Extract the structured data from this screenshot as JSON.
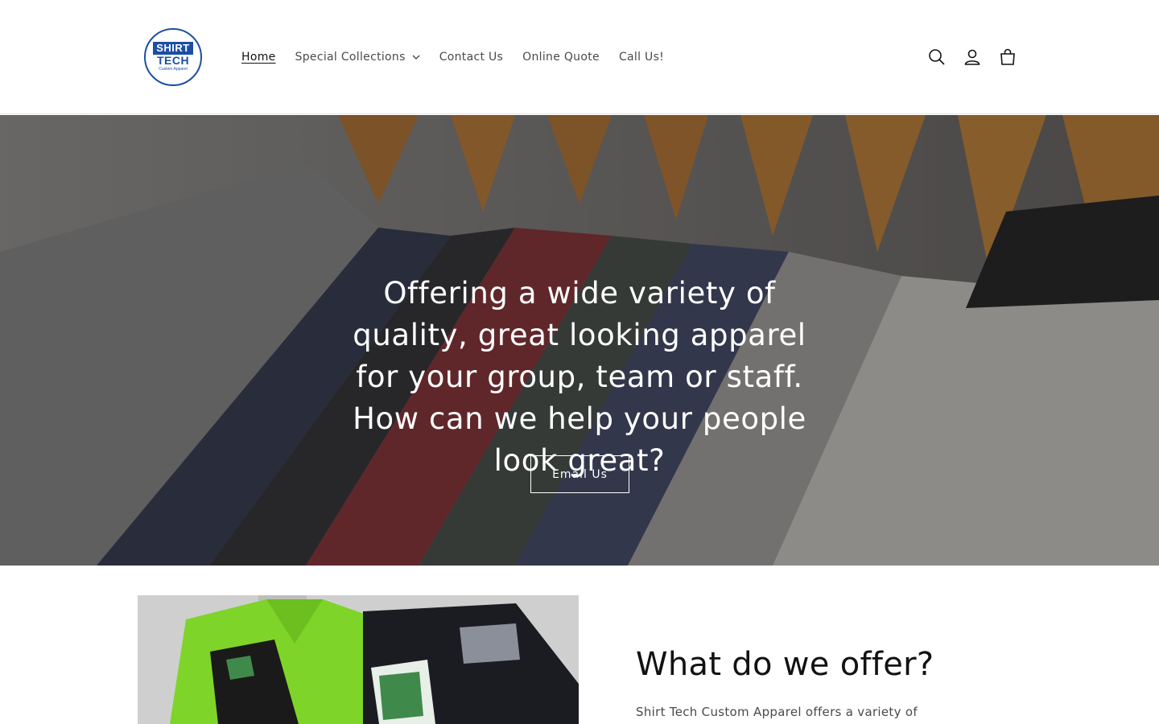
{
  "brand": {
    "logo_line1": "SHIRT",
    "logo_line2": "TECH",
    "logo_line3": "Custom Apparel",
    "color": "#1d4fa3"
  },
  "nav": {
    "items": [
      {
        "label": "Home",
        "active": true
      },
      {
        "label": "Special Collections",
        "dropdown": true
      },
      {
        "label": "Contact Us"
      },
      {
        "label": "Online Quote"
      },
      {
        "label": "Call Us!"
      }
    ]
  },
  "header_icons": [
    "search-icon",
    "account-icon",
    "cart-icon"
  ],
  "hero": {
    "heading": "Offering a wide variety of quality, great looking apparel for your group, team or staff. How can we help your people look great?",
    "button_label": "Email Us"
  },
  "offer": {
    "title": "What do we offer?",
    "text": "Shirt Tech Custom Apparel offers a variety of"
  }
}
